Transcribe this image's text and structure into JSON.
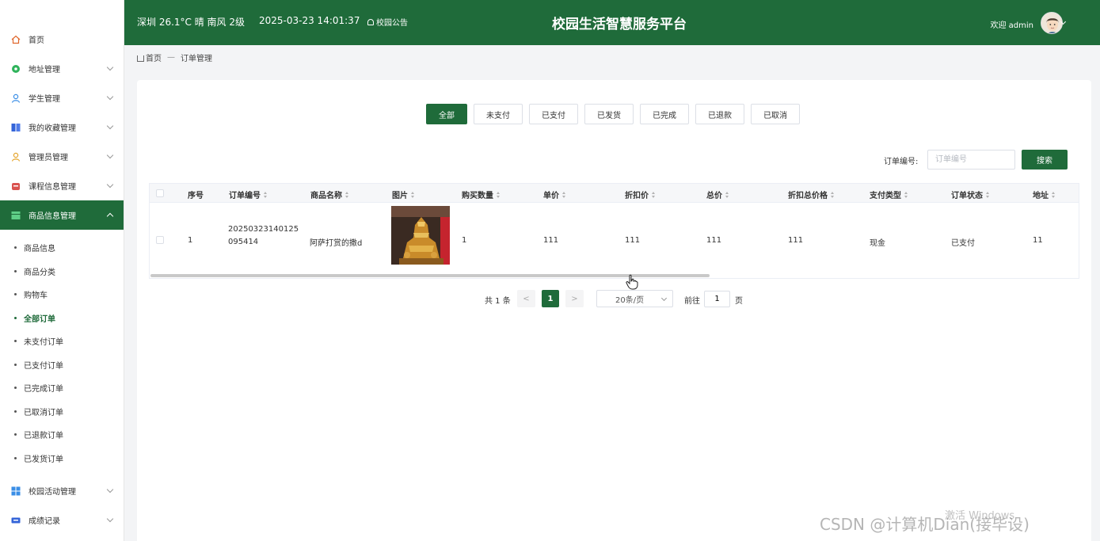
{
  "header": {
    "weather": "深圳 26.1°C 晴 南风 2级",
    "datetime": "2025-03-23 14:01:37",
    "notice": "校园公告",
    "title": "校园生活智慧服务平台",
    "welcome": "欢迎 admin"
  },
  "sidebar": {
    "items": [
      {
        "label": "首页",
        "icon": "home-icon",
        "color": "#e0672c"
      },
      {
        "label": "地址管理",
        "icon": "location-icon",
        "color": "#2fb35b"
      },
      {
        "label": "学生管理",
        "icon": "user-icon",
        "color": "#3a8ee6"
      },
      {
        "label": "我的收藏管理",
        "icon": "bookmark-icon",
        "color": "#3464d8"
      },
      {
        "label": "管理员管理",
        "icon": "admin-icon",
        "color": "#e5a42a"
      },
      {
        "label": "课程信息管理",
        "icon": "course-icon",
        "color": "#d9534f"
      },
      {
        "label": "商品信息管理",
        "icon": "goods-icon",
        "color": "#ffffff"
      }
    ],
    "subitems": [
      "商品信息",
      "商品分类",
      "购物车",
      "全部订单",
      "未支付订单",
      "已支付订单",
      "已完成订单",
      "已取消订单",
      "已退款订单",
      "已发货订单"
    ],
    "bottom_items": [
      {
        "label": "校园活动管理",
        "icon": "activity-icon",
        "color": "#3a8ee6"
      },
      {
        "label": "成绩记录",
        "icon": "score-icon",
        "color": "#3464d8"
      }
    ]
  },
  "breadcrumb": {
    "home": "首页",
    "separator": "—",
    "current": "订单管理"
  },
  "tabs": [
    "全部",
    "未支付",
    "已支付",
    "已发货",
    "已完成",
    "已退款",
    "已取消"
  ],
  "search": {
    "label": "订单编号:",
    "placeholder": "订单编号",
    "button": "搜索"
  },
  "table": {
    "columns": [
      "序号",
      "订单编号",
      "商品名称",
      "图片",
      "购买数量",
      "单价",
      "折扣价",
      "总价",
      "折扣总价格",
      "支付类型",
      "订单状态",
      "地址"
    ],
    "rows": [
      {
        "index": "1",
        "order_no": "20250323140125095414",
        "goods_name": "阿萨打赏的撒d",
        "quantity": "1",
        "price": "111",
        "discount_price": "111",
        "total": "111",
        "discount_total": "111",
        "pay_type": "现金",
        "status": "已支付",
        "address": "11"
      }
    ]
  },
  "pagination": {
    "total": "共 1 条",
    "prev": "<",
    "current": "1",
    "next": ">",
    "page_size": "20条/页",
    "goto_label": "前往",
    "goto_value": "1",
    "page_suffix": "页"
  },
  "overlay": {
    "watermark": "CSDN @计算机Dian(接毕设)",
    "windows": "激活 Windows"
  },
  "colors": {
    "primary": "#1f6b3a"
  }
}
